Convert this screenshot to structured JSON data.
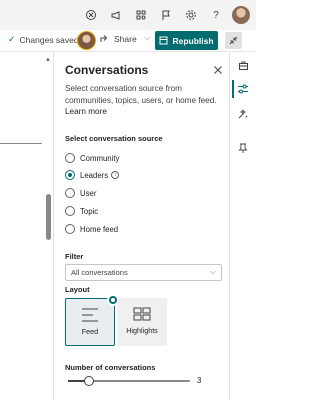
{
  "topbar": {
    "icons": [
      "onenote-icon",
      "megaphone-icon",
      "apps-icon",
      "flag-icon",
      "gear-icon",
      "help-icon",
      "user-avatar"
    ],
    "help_label": "?"
  },
  "cmdbar": {
    "saved_label": "Changes saved",
    "share_label": "Share",
    "publish_label": "Republish"
  },
  "panel": {
    "title": "Conversations",
    "description": "Select conversation source from communities, topics, users, or home feed.",
    "learn_more": "Learn more",
    "source_label": "Select conversation source",
    "sources": [
      {
        "label": "Community",
        "selected": false
      },
      {
        "label": "Leaders",
        "selected": true,
        "info": "i"
      },
      {
        "label": "User",
        "selected": false
      },
      {
        "label": "Topic",
        "selected": false
      },
      {
        "label": "Home feed",
        "selected": false
      }
    ],
    "filter_label": "Filter",
    "filter_value": "All conversations",
    "layout_label": "Layout",
    "layouts": [
      {
        "label": "Feed",
        "selected": true
      },
      {
        "label": "Highlights",
        "selected": false
      }
    ],
    "count_label": "Number of conversations",
    "count_value": "3",
    "count_fraction": 0.17
  },
  "colors": {
    "accent": "#036c70",
    "success": "#107c10"
  }
}
